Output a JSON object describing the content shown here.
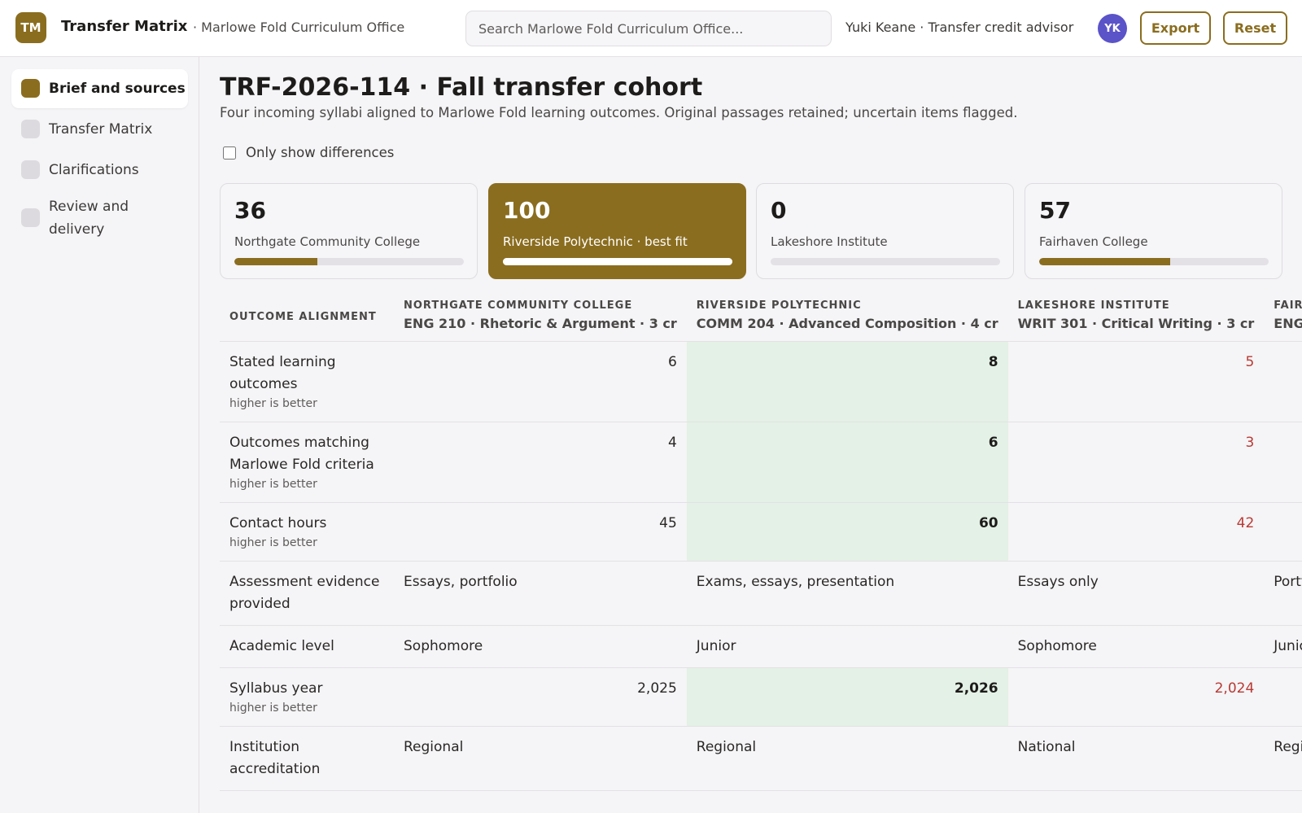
{
  "app": {
    "logo": "TM",
    "title": "Transfer Matrix",
    "org": "· Marlowe Fold Curriculum Office",
    "search_placeholder": "Search Marlowe Fold Curriculum Office...",
    "user": "Yuki Keane · Transfer credit advisor",
    "avatar": "YK",
    "export_label": "Export",
    "reset_label": "Reset"
  },
  "sidebar": {
    "items": [
      {
        "label": "Brief and sources",
        "active": true
      },
      {
        "label": "Transfer Matrix",
        "active": false
      },
      {
        "label": "Clarifications",
        "active": false
      },
      {
        "label": "Review and delivery",
        "active": false
      }
    ]
  },
  "page": {
    "title": "TRF-2026-114 · Fall transfer cohort",
    "subtitle": "Four incoming syllabi aligned to Marlowe Fold learning outcomes. Original passages retained; uncertain items flagged.",
    "diff_toggle_label": "Only show differences",
    "diff_toggle_checked": false
  },
  "score_cards": [
    {
      "score": "36",
      "name": "Northgate Community College",
      "fill": 0.36,
      "best": false
    },
    {
      "score": "100",
      "name": "Riverside Polytechnic · best fit",
      "fill": 1.0,
      "best": true
    },
    {
      "score": "0",
      "name": "Lakeshore Institute",
      "fill": 0.0,
      "best": false
    },
    {
      "score": "57",
      "name": "Fairhaven College",
      "fill": 0.57,
      "best": false
    }
  ],
  "matrix": {
    "rowhead_label": "OUTCOME ALIGNMENT",
    "columns": [
      {
        "institution": "NORTHGATE COMMUNITY COLLEGE",
        "course": "ENG 210 · Rhetoric & Argument · 3 cr"
      },
      {
        "institution": "RIVERSIDE POLYTECHNIC",
        "course": "COMM 204 · Advanced Composition · 4 cr"
      },
      {
        "institution": "LAKESHORE INSTITUTE",
        "course": "WRIT 301 · Critical Writing · 3 cr"
      },
      {
        "institution": "FAIRH",
        "course": "ENGL"
      }
    ],
    "rows": [
      {
        "label": "Stated learning outcomes",
        "hint": "higher is better",
        "values": [
          "6",
          "8",
          "5",
          ""
        ]
      },
      {
        "label": "Outcomes matching Marlowe Fold criteria",
        "hint": "higher is better",
        "values": [
          "4",
          "6",
          "3",
          ""
        ]
      },
      {
        "label": "Contact hours",
        "hint": "higher is better",
        "values": [
          "45",
          "60",
          "42",
          ""
        ]
      },
      {
        "label": "Assessment evidence provided",
        "hint": "",
        "values": [
          "Essays, portfolio",
          "Exams, essays, presentation",
          "Essays only",
          "Portfc"
        ]
      },
      {
        "label": "Academic level",
        "hint": "",
        "values": [
          "Sophomore",
          "Junior",
          "Sophomore",
          "Junio"
        ]
      },
      {
        "label": "Syllabus year",
        "hint": "higher is better",
        "values": [
          "2,025",
          "2,026",
          "2,024",
          ""
        ]
      },
      {
        "label": "Institution accreditation",
        "hint": "",
        "values": [
          "Regional",
          "Regional",
          "National",
          "Regio"
        ]
      }
    ]
  },
  "colors": {
    "accent": "#8a6d1f",
    "best_cell": "#e4f1e6",
    "low_value": "#b83a34",
    "avatar": "#5b53c8"
  }
}
